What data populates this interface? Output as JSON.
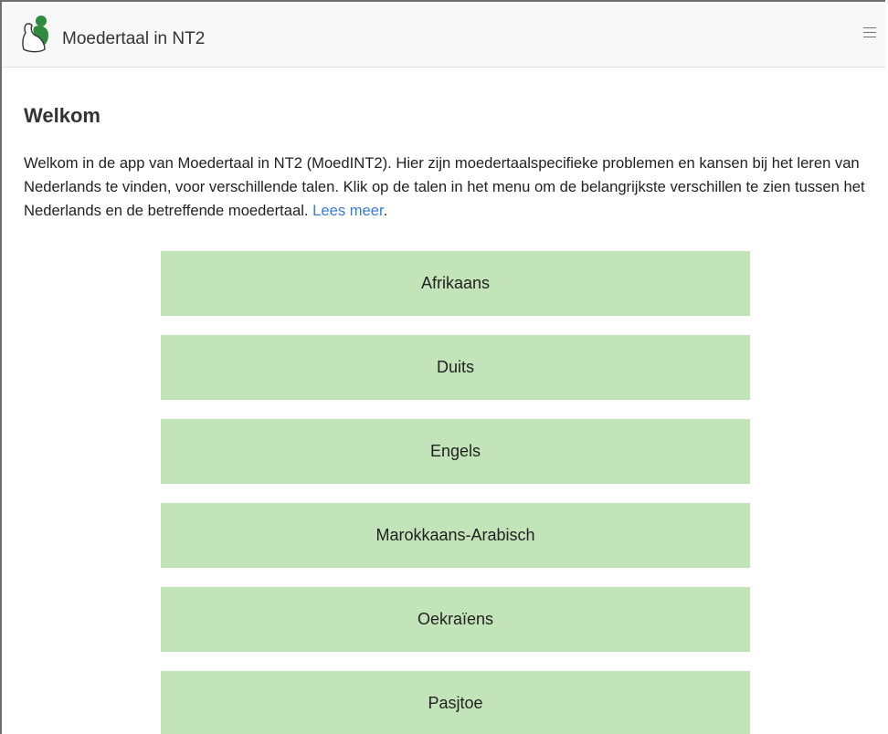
{
  "navbar": {
    "brand": "Moedertaal in NT2",
    "logo_icon": "two-people-logo-icon",
    "menu_icon": "hamburger-menu-icon"
  },
  "main": {
    "heading": "Welkom",
    "intro_text": "Welkom in de app van Moedertaal in NT2 (MoedINT2). Hier zijn moedertaalspecifieke problemen en kansen bij het leren van Nederlands te vinden, voor verschillende talen. Klik op de talen in het menu om de belangrijkste verschillen te zien tussen het Nederlands en de betreffende moedertaal.",
    "read_more_link": "Lees meer",
    "intro_suffix": "."
  },
  "languages": [
    "Afrikaans",
    "Duits",
    "Engels",
    "Marokkaans-Arabisch",
    "Oekraïens",
    "Pasjtoe"
  ],
  "colors": {
    "button_bg": "#c2e4b8",
    "link": "#3a7bd5",
    "navbar_bg": "#f8f8f8",
    "logo_green": "#2e8b3e"
  }
}
